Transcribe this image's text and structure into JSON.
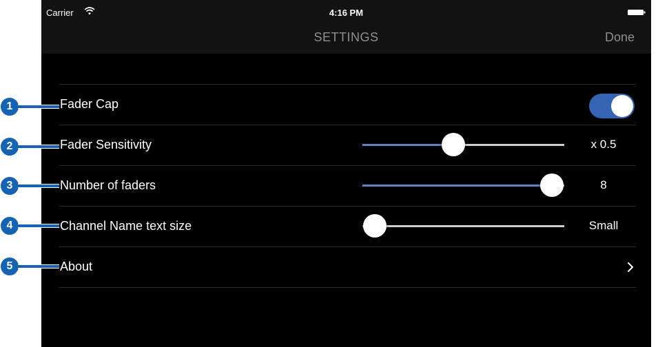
{
  "status_bar": {
    "carrier": "Carrier",
    "time": "4:16 PM",
    "wifi_icon": "wifi-icon",
    "battery_icon": "battery-full-icon"
  },
  "nav": {
    "title": "SETTINGS",
    "done_label": "Done"
  },
  "settings": {
    "fader_cap": {
      "label": "Fader Cap",
      "enabled": true
    },
    "fader_sensitivity": {
      "label": "Fader Sensitivity",
      "value": "x 0.5",
      "position": 0.45
    },
    "number_of_faders": {
      "label": "Number of faders",
      "value": "8",
      "position": 0.94
    },
    "channel_name_text_size": {
      "label": "Channel Name text size",
      "value": "Small",
      "position": 0.06
    },
    "about": {
      "label": "About",
      "icon": "chevron-right-icon"
    }
  },
  "callouts": [
    "1",
    "2",
    "3",
    "4",
    "5"
  ],
  "colors": {
    "toggle_on": "#3763b5",
    "slider_fill": "#5b86c5",
    "callout_badge": "#1563b2",
    "background": "#000000",
    "bar_background": "#121212"
  }
}
